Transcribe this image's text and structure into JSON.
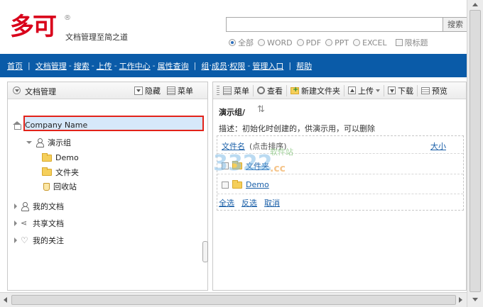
{
  "header": {
    "logo_text": "多可",
    "logo_reg": "®",
    "slogan": "文档管理至简之道",
    "search": {
      "value": "",
      "button": "搜索"
    },
    "filters": [
      {
        "label": "全部",
        "checked": true
      },
      {
        "label": "WORD",
        "checked": false
      },
      {
        "label": "PDF",
        "checked": false
      },
      {
        "label": "PPT",
        "checked": false
      },
      {
        "label": "EXCEL",
        "checked": false
      }
    ],
    "title_only_label": "限标题"
  },
  "nav": {
    "home": "首页",
    "docs": "文档管理",
    "search": "搜索",
    "upload": "上传",
    "workcenter": "工作中心",
    "attr_query": "属性查询",
    "group": "组",
    "member": "成员",
    "permission": "权限",
    "admin": "管理入口",
    "help": "帮助"
  },
  "left_panel": {
    "title": "文档管理",
    "hide_label": "隐藏",
    "menu_label": "菜单",
    "tree": {
      "root": "Company Name",
      "selected_group": "演示组",
      "children": [
        "Demo",
        "文件夹",
        "回收站"
      ],
      "my_docs": "我的文档",
      "shared_docs": "共享文档",
      "my_follow": "我的关注"
    }
  },
  "right_panel": {
    "toolbar": {
      "menu": "菜单",
      "view": "查看",
      "new_folder": "新建文件夹",
      "upload": "上传",
      "download": "下载",
      "preview": "预览"
    },
    "breadcrumb": "演示组/",
    "description": "描述：初始化时创建的，供演示用，可以删除",
    "columns": {
      "name": "文件名",
      "sort_hint": "(点击排序)",
      "size": "大小"
    },
    "files": [
      "文件夹",
      "Demo"
    ],
    "actions": {
      "select_all": "全选",
      "invert": "反选",
      "cancel": "取消"
    }
  }
}
